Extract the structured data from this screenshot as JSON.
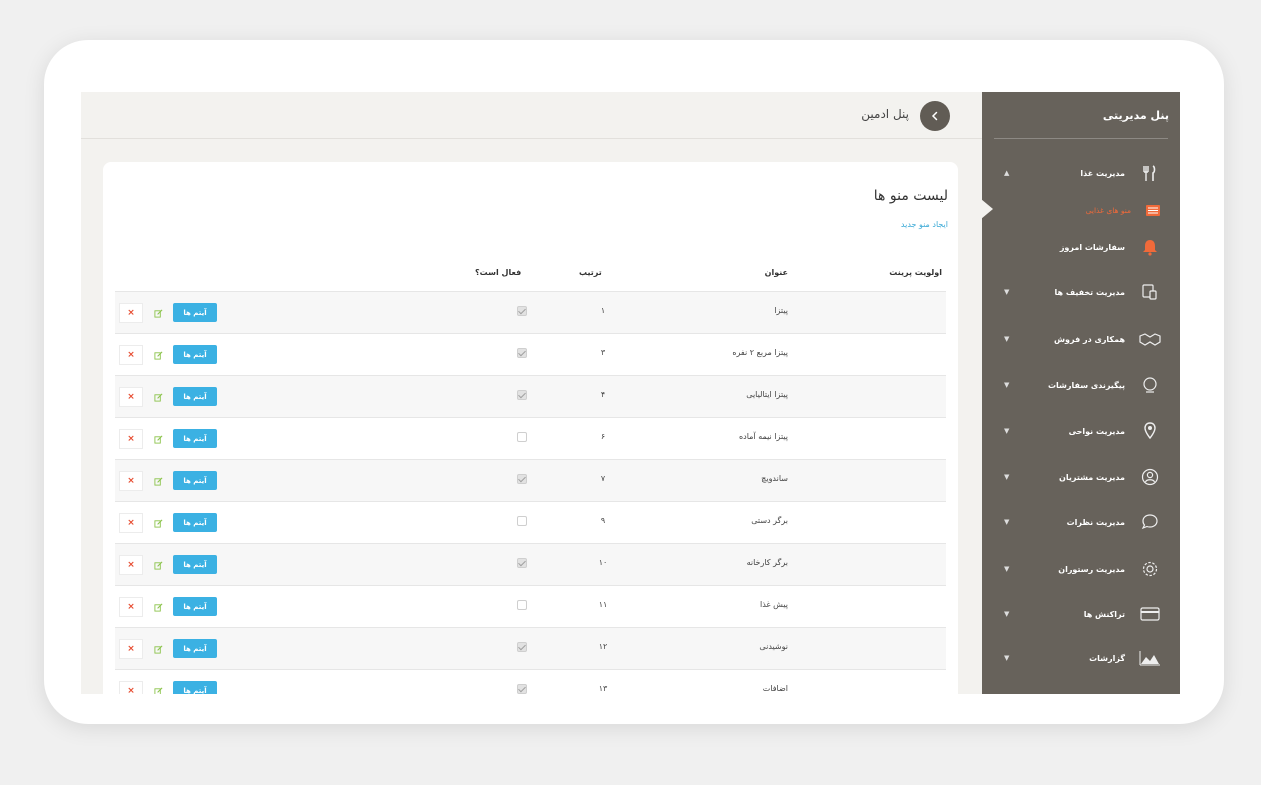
{
  "sidebar": {
    "title": "پنل مدیریتی",
    "items": [
      {
        "label": "مدیریت غذا",
        "icon": "fork-knife-icon",
        "caret": "▲"
      },
      {
        "label": "منو های غذایی",
        "icon": "list-icon",
        "sub": true
      },
      {
        "label": "سفارشات امروز",
        "icon": "bell-icon"
      },
      {
        "label": "مدیریت تخفیف ها",
        "icon": "discount-icon",
        "caret": "▼"
      },
      {
        "label": "همکاری در فروش",
        "icon": "handshake-icon",
        "caret": "▼"
      },
      {
        "label": "پیگیرندی سفارشات",
        "icon": "globe-icon",
        "caret": "▼"
      },
      {
        "label": "مدیریت نواحی",
        "icon": "location-pin-icon",
        "caret": "▼"
      },
      {
        "label": "مدیریت مشتریان",
        "icon": "user-circle-icon",
        "caret": "▼"
      },
      {
        "label": "مدیریت نظرات",
        "icon": "chat-bubble-icon",
        "caret": "▼"
      },
      {
        "label": "مدیریت رستوران",
        "icon": "gear-icon",
        "caret": "▼"
      },
      {
        "label": "تراکنش ها",
        "icon": "credit-card-icon",
        "caret": "▼"
      },
      {
        "label": "گزارشات",
        "icon": "area-chart-icon",
        "caret": "▼"
      }
    ]
  },
  "header": {
    "title": "پنل ادمین"
  },
  "card": {
    "title": "لیست منو ها",
    "new_link": "ایجاد منو جدید",
    "columns": {
      "parent": "اولویت پرینت",
      "title": "عنوان",
      "order": "ترتیب",
      "active": "فعال است؟"
    },
    "items_button": "آیتم ها",
    "delete_glyph": "×",
    "rows": [
      {
        "title": "پیتزا",
        "order": "۱",
        "active": true
      },
      {
        "title": "پیتزا مربع ۲ نفره",
        "order": "۳",
        "active": true
      },
      {
        "title": "پیتزا ایتالیایی",
        "order": "۴",
        "active": true
      },
      {
        "title": "پیتزا نیمه آماده",
        "order": "۶",
        "active": false
      },
      {
        "title": "ساندویچ",
        "order": "۷",
        "active": true
      },
      {
        "title": "برگر دستی",
        "order": "۹",
        "active": false
      },
      {
        "title": "برگر کارخانه",
        "order": "۱۰",
        "active": true
      },
      {
        "title": "پیش غذا",
        "order": "۱۱",
        "active": false
      },
      {
        "title": "نوشیدنی",
        "order": "۱۲",
        "active": true
      },
      {
        "title": "اضافات",
        "order": "۱۳",
        "active": true
      }
    ]
  },
  "colors": {
    "sidebar": "#67625b",
    "accent": "#3bb1e3",
    "danger": "#e64a2e",
    "active_sub": "#f06a3a"
  }
}
